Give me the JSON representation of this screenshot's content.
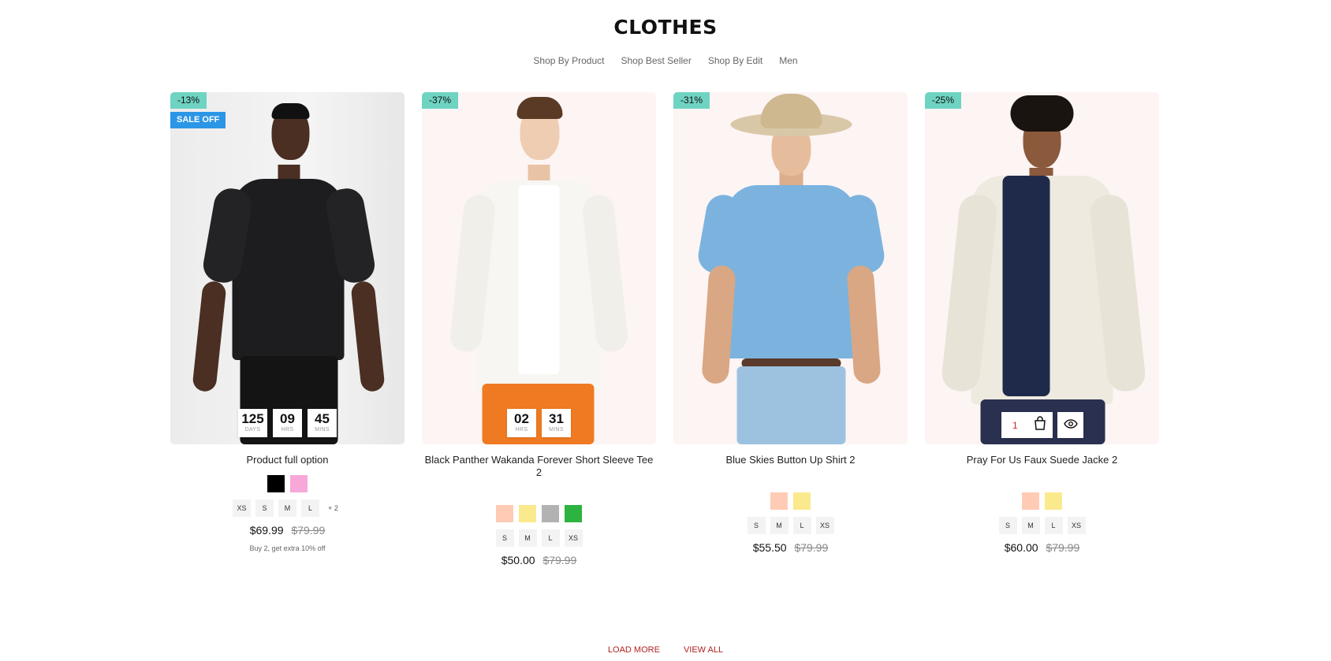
{
  "section": {
    "title": "CLOTHES"
  },
  "tabs": [
    "Shop By Product",
    "Shop Best Seller",
    "Shop By Edit",
    "Men"
  ],
  "products": [
    {
      "discount": "-13%",
      "sale_badge": "SALE OFF",
      "countdown": [
        {
          "value": "125",
          "unit": "DAYS"
        },
        {
          "value": "09",
          "unit": "HRS"
        },
        {
          "value": "45",
          "unit": "MINS"
        }
      ],
      "name": "Product full option",
      "colors": [
        "#000000",
        "#f7a8d8"
      ],
      "sizes": [
        "XS",
        "S",
        "M",
        "L"
      ],
      "more_sizes": "+ 2",
      "price": "$69.99",
      "compare_price": "$79.99",
      "promo": "Buy 2, get extra 10% off"
    },
    {
      "discount": "-37%",
      "countdown": [
        {
          "value": "02",
          "unit": "HRS"
        },
        {
          "value": "31",
          "unit": "MINS"
        }
      ],
      "name": "Black Panther Wakanda Forever Short Sleeve Tee 2",
      "colors": [
        "#ffcbb5",
        "#fbe98e",
        "#b2b2b2",
        "#2db33f"
      ],
      "sizes": [
        "S",
        "M",
        "L",
        "XS"
      ],
      "price": "$50.00",
      "compare_price": "$79.99"
    },
    {
      "discount": "-31%",
      "name": "Blue Skies Button Up Shirt 2",
      "colors": [
        "#ffcbb5",
        "#fbe98e"
      ],
      "sizes": [
        "S",
        "M",
        "L",
        "XS"
      ],
      "price": "$55.50",
      "compare_price": "$79.99"
    },
    {
      "discount": "-25%",
      "quantity": "1",
      "icons": [
        "shopping-bag-icon",
        "eye-icon"
      ],
      "name": "Pray For Us Faux Suede Jacke 2",
      "colors": [
        "#ffcbb5",
        "#fbe98e"
      ],
      "sizes": [
        "S",
        "M",
        "L",
        "XS"
      ],
      "price": "$60.00",
      "compare_price": "$79.99"
    }
  ],
  "footer": {
    "load_more": "LOAD MORE",
    "view_all": "VIEW ALL"
  }
}
